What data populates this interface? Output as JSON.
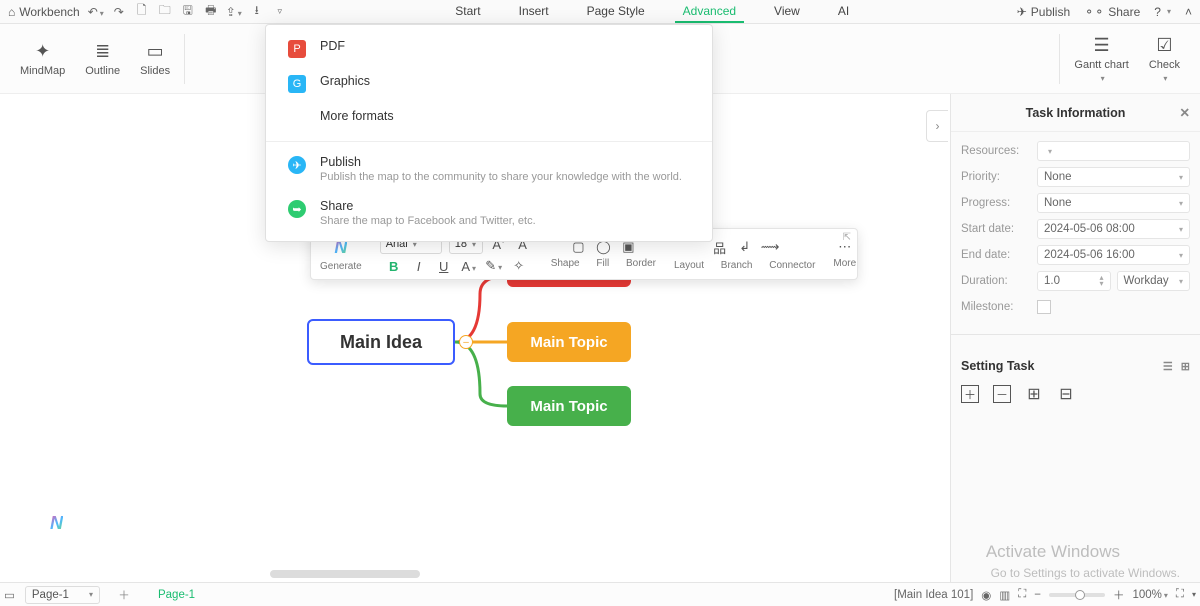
{
  "topbar": {
    "workbench": "Workbench",
    "menu": [
      "Start",
      "Insert",
      "Page Style",
      "Advanced",
      "View",
      "AI"
    ],
    "active_menu": 3,
    "publish": "Publish",
    "share": "Share"
  },
  "ribbon": {
    "groups": [
      "MindMap",
      "Outline",
      "Slides"
    ],
    "gantt": "Gantt chart",
    "check": "Check"
  },
  "dropdown": {
    "pdf": "PDF",
    "graphics": "Graphics",
    "more": "More formats",
    "publish_t": "Publish",
    "publish_s": "Publish the map to the community to share your knowledge with the world.",
    "share_t": "Share",
    "share_s": "Share the map to Facebook and Twitter, etc."
  },
  "nodes": {
    "main": "Main Idea",
    "amber": "Main Topic",
    "green": "Main Topic"
  },
  "floatbar": {
    "generate": "Generate",
    "font": "Arial",
    "size": "18",
    "shape": "Shape",
    "fill": "Fill",
    "border": "Border",
    "layout": "Layout",
    "branch": "Branch",
    "connector": "Connector",
    "more": "More"
  },
  "panel": {
    "title": "Task Information",
    "resources": "Resources:",
    "priority": "Priority:",
    "priority_v": "None",
    "progress": "Progress:",
    "progress_v": "None",
    "start": "Start date:",
    "start_v": "2024-05-06   08:00",
    "end": "End date:",
    "end_v": "2024-05-06   16:00",
    "duration": "Duration:",
    "duration_v": "1.0",
    "duration_u": "Workday",
    "milestone": "Milestone:",
    "setting": "Setting Task"
  },
  "status": {
    "pageSel": "Page-1",
    "pageTab": "Page-1",
    "docinfo": "[Main Idea 101]",
    "zoom": "100%"
  },
  "watermark": {
    "l1": "Activate Windows",
    "l2": "Go to Settings to activate Windows."
  }
}
